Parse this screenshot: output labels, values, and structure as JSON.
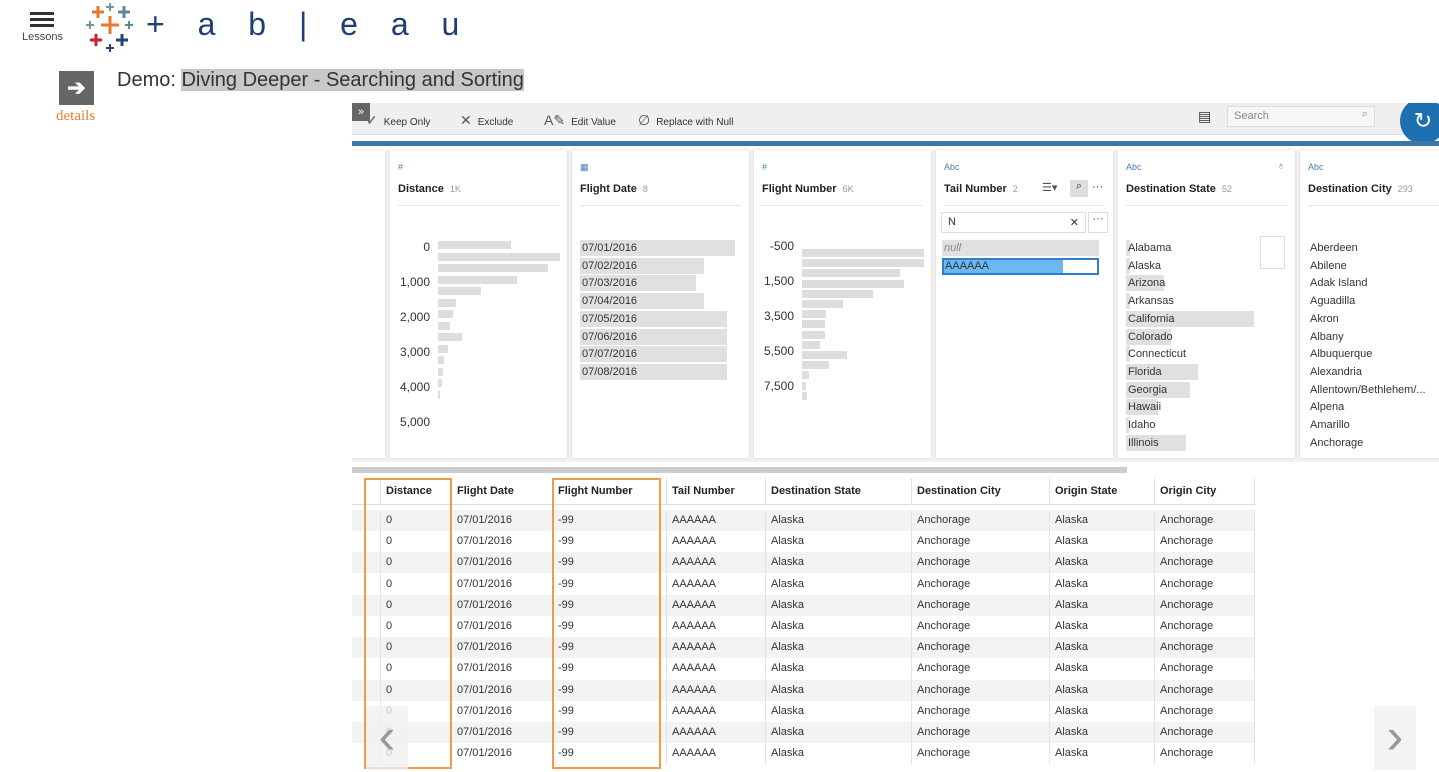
{
  "header": {
    "menu_label": "Lessons",
    "logo_text": "+ a b | e a u",
    "brand_colors": [
      "#e8762c",
      "#c72037",
      "#5b879b",
      "#1f447e",
      "#7099a6"
    ]
  },
  "lesson": {
    "prefix": "Demo:",
    "title": "Diving Deeper - Searching and Sorting",
    "details_label": "details"
  },
  "toolbar": {
    "keep_only": "Keep Only",
    "exclude": "Exclude",
    "edit_value": "Edit Value",
    "replace_null": "Replace with Null",
    "search_placeholder": "Search"
  },
  "cards": {
    "distance": {
      "type": "#",
      "title": "Distance",
      "count": "1K",
      "axis": [
        "0",
        "1,000",
        "2,000",
        "3,000",
        "4,000",
        "5,000"
      ],
      "bar_levels": [
        0.6,
        1,
        0.9,
        0.65,
        0.35,
        0.15,
        0.12,
        0.1,
        0.2,
        0.08,
        0.05,
        0.04,
        0.03,
        0.02
      ]
    },
    "flight_date": {
      "type": "cal",
      "title": "Flight Date",
      "count": "8",
      "values": [
        "07/01/2016",
        "07/02/2016",
        "07/03/2016",
        "07/04/2016",
        "07/05/2016",
        "07/06/2016",
        "07/07/2016",
        "07/08/2016"
      ],
      "bar_levels": [
        1,
        0.8,
        0.75,
        0.8,
        0.95,
        0.95,
        0.95,
        0.95
      ]
    },
    "flight_number": {
      "type": "#",
      "title": "Flight Number",
      "count": "6K",
      "axis": [
        "-500",
        "1,500",
        "3,500",
        "5,500",
        "7,500"
      ],
      "bar_levels": [
        1,
        1,
        0.8,
        0.84,
        0.58,
        0.34,
        0.2,
        0.19,
        0.19,
        0.15,
        0.37,
        0.22,
        0.06,
        0.03,
        0.04
      ]
    },
    "tail_number": {
      "type": "Abc",
      "title": "Tail Number",
      "count": "2",
      "search_value": "N",
      "values": [
        "null",
        "AAAAAA"
      ],
      "selected": "AAAAAA"
    },
    "destination_state": {
      "type": "Abc",
      "title": "Destination State",
      "count": "52",
      "values": [
        "Alabama",
        "Alaska",
        "Arizona",
        "Arkansas",
        "California",
        "Colorado",
        "Connecticut",
        "Florida",
        "Georgia",
        "Hawaii",
        "Idaho",
        "Illinois"
      ],
      "bar_levels": [
        0.03,
        0.03,
        0.3,
        0.03,
        1,
        0.35,
        0.03,
        0.56,
        0.5,
        0.25,
        0.02,
        0.47
      ]
    },
    "destination_city": {
      "type": "Abc",
      "title": "Destination City",
      "count": "293",
      "values": [
        "Aberdeen",
        "Abilene",
        "Adak Island",
        "Aguadilla",
        "Akron",
        "Albany",
        "Albuquerque",
        "Alexandria",
        "Allentown/Bethlehem/...",
        "Alpena",
        "Amarillo",
        "Anchorage"
      ]
    }
  },
  "table": {
    "columns": [
      "Distance",
      "Flight Date",
      "Flight Number",
      "Tail Number",
      "Destination State",
      "Destination City",
      "Origin State",
      "Origin City"
    ],
    "rows": [
      [
        "0",
        "07/01/2016",
        "-99",
        "AAAAAA",
        "Alaska",
        "Anchorage",
        "Alaska",
        "Anchorage"
      ],
      [
        "0",
        "07/01/2016",
        "-99",
        "AAAAAA",
        "Alaska",
        "Anchorage",
        "Alaska",
        "Anchorage"
      ],
      [
        "0",
        "07/01/2016",
        "-99",
        "AAAAAA",
        "Alaska",
        "Anchorage",
        "Alaska",
        "Anchorage"
      ],
      [
        "0",
        "07/01/2016",
        "-99",
        "AAAAAA",
        "Alaska",
        "Anchorage",
        "Alaska",
        "Anchorage"
      ],
      [
        "0",
        "07/01/2016",
        "-99",
        "AAAAAA",
        "Alaska",
        "Anchorage",
        "Alaska",
        "Anchorage"
      ],
      [
        "0",
        "07/01/2016",
        "-99",
        "AAAAAA",
        "Alaska",
        "Anchorage",
        "Alaska",
        "Anchorage"
      ],
      [
        "0",
        "07/01/2016",
        "-99",
        "AAAAAA",
        "Alaska",
        "Anchorage",
        "Alaska",
        "Anchorage"
      ],
      [
        "0",
        "07/01/2016",
        "-99",
        "AAAAAA",
        "Alaska",
        "Anchorage",
        "Alaska",
        "Anchorage"
      ],
      [
        "0",
        "07/01/2016",
        "-99",
        "AAAAAA",
        "Alaska",
        "Anchorage",
        "Alaska",
        "Anchorage"
      ],
      [
        "0",
        "07/01/2016",
        "-99",
        "AAAAAA",
        "Alaska",
        "Anchorage",
        "Alaska",
        "Anchorage"
      ],
      [
        "0",
        "07/01/2016",
        "-99",
        "AAAAAA",
        "Alaska",
        "Anchorage",
        "Alaska",
        "Anchorage"
      ],
      [
        "0",
        "07/01/2016",
        "-99",
        "AAAAAA",
        "Alaska",
        "Anchorage",
        "Alaska",
        "Anchorage"
      ]
    ],
    "highlighted_columns": [
      "Distance",
      "Flight Number"
    ],
    "highlight_color": "#f09a4e"
  }
}
